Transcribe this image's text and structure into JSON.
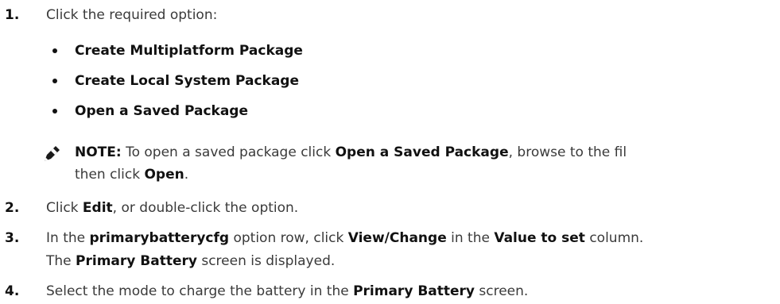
{
  "steps": [
    {
      "number": "1.",
      "text": "Click the required option:",
      "options": [
        "Create Multiplatform Package",
        "Create Local System Package",
        "Open a Saved Package"
      ],
      "note": {
        "label": "NOTE:",
        "text_1": " To open a saved package click ",
        "bold_1": "Open a Saved Package",
        "text_2": ", browse to the fil",
        "text_3": "then click ",
        "bold_2": "Open",
        "text_4": "."
      }
    },
    {
      "number": "2.",
      "text_1": "Click ",
      "bold_1": "Edit",
      "text_2": ", or double-click the option."
    },
    {
      "number": "3.",
      "text_1": "In the ",
      "bold_1": "primarybatterycfg",
      "text_2": " option row, click ",
      "bold_2": "View/Change",
      "text_3": " in the ",
      "bold_3": "Value to set",
      "text_4": " column.",
      "result_1": "The ",
      "result_bold": "Primary Battery",
      "result_2": " screen is displayed."
    },
    {
      "number": "4.",
      "text_1": "Select the mode to charge the battery in the ",
      "bold_1": "Primary Battery",
      "text_2": " screen."
    }
  ],
  "icons": {
    "note": "pencil-note-icon"
  }
}
